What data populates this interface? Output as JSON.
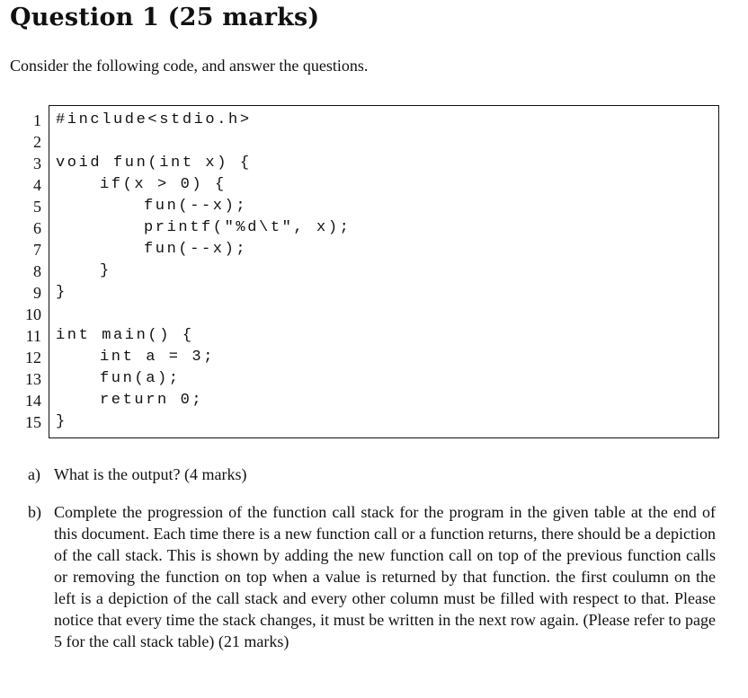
{
  "document": {
    "title": "Question 1 (25 marks)",
    "intro": "Consider the following code, and answer the questions.",
    "code_listing": [
      {
        "line": "1",
        "text": "#include<stdio.h>",
        "indent": 0
      },
      {
        "line": "2",
        "text": "",
        "indent": 0
      },
      {
        "line": "3",
        "text": "void fun(int x) {",
        "indent": 0
      },
      {
        "line": "4",
        "text": "if(x > 0) {",
        "indent": 1
      },
      {
        "line": "5",
        "text": "fun(--x);",
        "indent": 2
      },
      {
        "line": "6",
        "text": "printf(\"%d\\t\", x);",
        "indent": 2
      },
      {
        "line": "7",
        "text": "fun(--x);",
        "indent": 2
      },
      {
        "line": "8",
        "text": "}",
        "indent": 1
      },
      {
        "line": "9",
        "text": "}",
        "indent": 0
      },
      {
        "line": "10",
        "text": "",
        "indent": 0
      },
      {
        "line": "11",
        "text": "int main() {",
        "indent": 0
      },
      {
        "line": "12",
        "text": "int a = 3;",
        "indent": 1
      },
      {
        "line": "13",
        "text": "fun(a);",
        "indent": 1
      },
      {
        "line": "14",
        "text": "return 0;",
        "indent": 1
      },
      {
        "line": "15",
        "text": "}",
        "indent": 0
      }
    ],
    "questions": [
      {
        "label": "a)",
        "text": "What is the output? (4 marks)"
      },
      {
        "label": "b)",
        "text": "Complete the progression of the function call stack for the program in the given table at the end of this document. Each time there is a new function call or a function returns, there should be a depiction of the call stack. This is shown by adding the new function call on top of the previous function calls or removing the function on top when a value is returned by that function.  the first coulumn on the left is a depiction of the call stack and every other column must be filled with respect to that. Please notice that every time the stack changes, it must be written in the next row again. (Please refer to page 5 for the call stack table) (21 marks)"
      }
    ]
  }
}
